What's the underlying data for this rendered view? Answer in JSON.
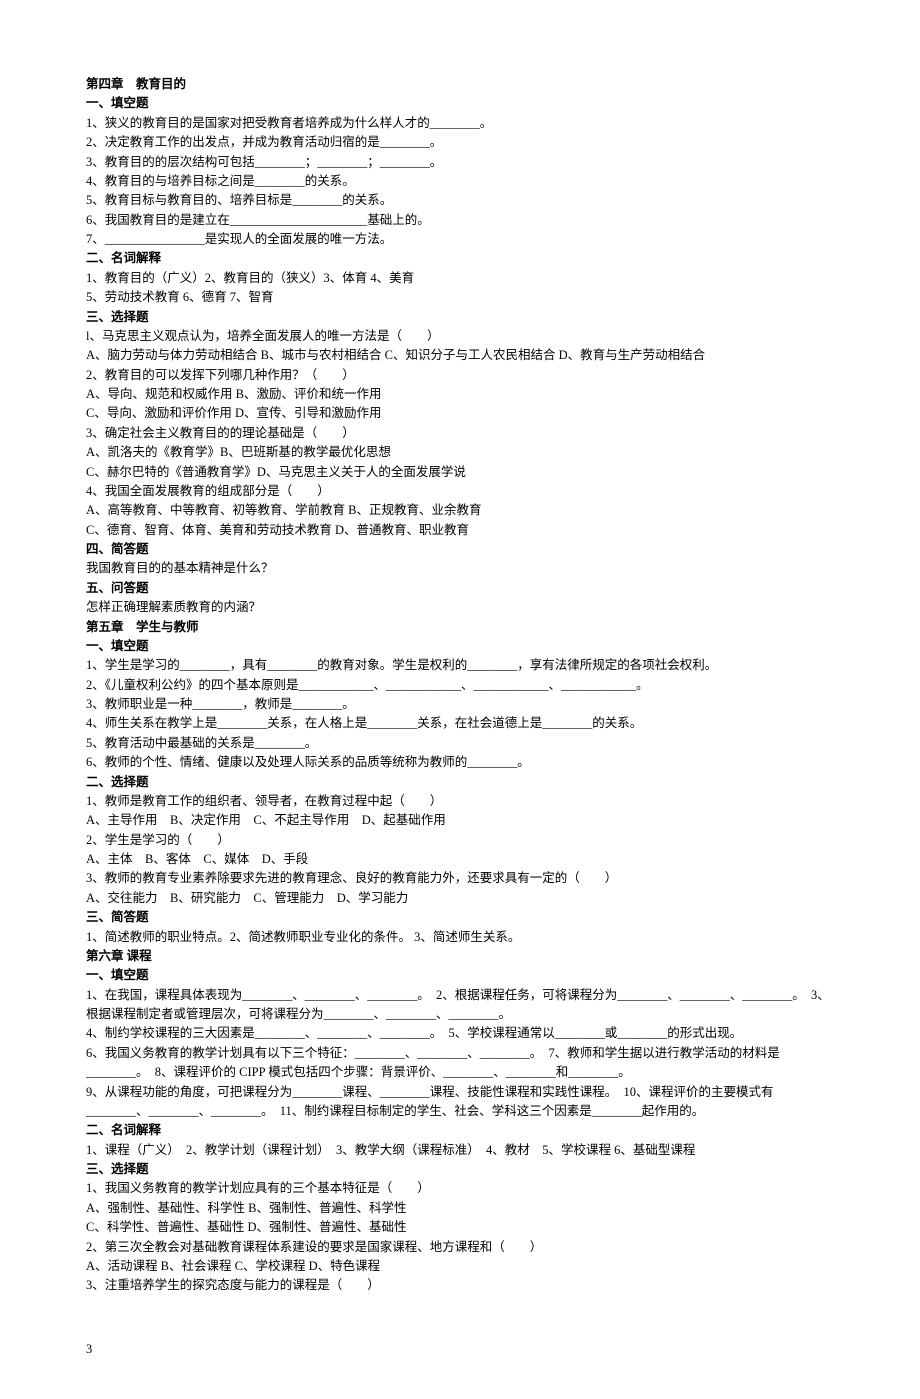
{
  "ch4": {
    "title": "第四章　教育目的",
    "s1": {
      "h": "一、填空题",
      "l1": "1、狭义的教育目的是国家对把受教育者培养成为什么样人才的________。",
      "l2": "2、决定教育工作的出发点，并成为教育活动归宿的是________。",
      "l3": "3、教育目的的层次结构可包括________；________；________。",
      "l4": "4、教育目的与培养目标之间是________的关系。",
      "l5": "5、教育目标与教育目的、培养目标是________的关系。",
      "l6": "6、我国教育目的是建立在______________________基础上的。",
      "l7": "7、________________是实现人的全面发展的唯一方法。"
    },
    "s2": {
      "h": "二、名词解释",
      "l1": "1、教育目的（广义）2、教育目的（狭义）3、体育 4、美育",
      "l2": "5、劳动技术教育 6、德育 7、智育"
    },
    "s3": {
      "h": "三、选择题",
      "q1": "l、马克思主义观点认为，培养全面发展人的唯一方法是（　　）",
      "q1opt": "A、脑力劳动与体力劳动相结合 B、城市与农村相结合 C、知识分子与工人农民相结合 D、教育与生产劳动相结合",
      "q2": "2、教育目的可以发挥下列哪几种作用？（　　）",
      "q2a": "A、导向、规范和权威作用 B、激励、评价和统一作用",
      "q2b": "C、导向、激励和评价作用 D、宣传、引导和激励作用",
      "q3": "3、确定社会主义教育目的的理论基础是（　　）",
      "q3a": "A、凯洛夫的《教育学》B、巴班斯基的教学最优化思想",
      "q3b": "C、赫尔巴特的《普通教育学》D、马克思主义关于人的全面发展学说",
      "q4": "4、我国全面发展教育的组成部分是（　　）",
      "q4a": "A、高等教育、中等教育、初等教育、学前教育 B、正规教育、业余教育",
      "q4b": "C、德育、智育、体育、美育和劳动技术教育 D、普通教育、职业教育"
    },
    "s4": {
      "h": "四、简答题",
      "l1": "我国教育目的的基本精神是什么？"
    },
    "s5": {
      "h": "五、问答题",
      "l1": "怎样正确理解素质教育的内涵？"
    }
  },
  "ch5": {
    "title": "第五章　学生与教师",
    "s1": {
      "h": "一、填空题",
      "l1": "1、学生是学习的________，具有________的教育对象。学生是权利的________，享有法律所规定的各项社会权利。",
      "l2": "2、《儿童权利公约》的四个基本原则是____________、____________、____________、____________。",
      "l3": "3、教师职业是一种________，教师是________。",
      "l4": "4、师生关系在教学上是________关系，在人格上是________关系，在社会道德上是________的关系。",
      "l5": "5、教育活动中最基础的关系是________。",
      "l6": "6、教师的个性、情绪、健康以及处理人际关系的品质等统称为教师的________。"
    },
    "s2": {
      "h": "二、选择题",
      "q1": "1、教师是教育工作的组织者、领导者，在教育过程中起（　　）",
      "q1opt": "A、主导作用　B、决定作用　C、不起主导作用　D、起基础作用",
      "q2": "2、学生是学习的（　　）",
      "q2opt": "A、主体　B、客体　C、媒体　D、手段",
      "q3": "3、教师的教育专业素养除要求先进的教育理念、良好的教育能力外，还要求具有一定的（　　）",
      "q3opt": "A、交往能力　B、研究能力　C、管理能力　D、学习能力"
    },
    "s3": {
      "h": "三、简答题",
      "l1": "1、简述教师的职业特点。2、简述教师职业专业化的条件。 3、简述师生关系。"
    }
  },
  "ch6": {
    "title": "第六章 课程",
    "s1": {
      "h": "一、填空题",
      "l1": "1、在我国，课程具体表现为________、________、________。　2、根据课程任务，可将课程分为________、________、________。　3、根据课程制定者或管理层次，可将课程分为________、________、________。",
      "l2": "4、制约学校课程的三大因素是________、________、________。　5、学校课程通常以________或________的形式出现。",
      "l3": "6、我国义务教育的教学计划具有以下三个特征：________、________、________。　7、教师和学生据以进行教学活动的材料是________。　8、课程评价的 CIPP 模式包括四个步骤：背景评价、________、________和________。",
      "l4": "9、从课程功能的角度，可把课程分为________课程、________课程、技能性课程和实践性课程。　10、课程评价的主要模式有________、________、________。　11、制约课程目标制定的学生、社会、学科这三个因素是________起作用的。"
    },
    "s2": {
      "h": "二、名词解释",
      "l1": "1、课程（广义）　2、教学计划（课程计划）　3、教学大纲（课程标准）　4、教材　5、学校课程 6、基础型课程"
    },
    "s3": {
      "h": "三、选择题",
      "q1": "1、我国义务教育的教学计划应具有的三个基本特征是（　　）",
      "q1a": "A、强制性、基础性、科学性 B、强制性、普遍性、科学性",
      "q1b": "C、科学性、普遍性、基础性 D、强制性、普遍性、基础性",
      "q2": "2、第三次全教会对基础教育课程体系建设的要求是国家课程、地方课程和（　　）",
      "q2opt": "A、活动课程 B、社会课程 C、学校课程 D、特色课程",
      "q3": "3、注重培养学生的探究态度与能力的课程是（　　）"
    }
  },
  "pagenum": "3"
}
